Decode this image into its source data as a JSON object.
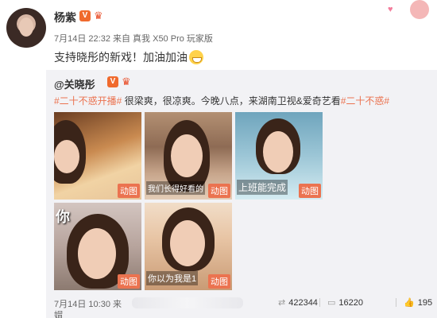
{
  "user": {
    "name": "杨紫",
    "verified_label": "V",
    "meta": "7月14日 22:32 来自 真我 X50 Pro 玩家版",
    "text": "支持晓彤的新戏！加油加油"
  },
  "repost": {
    "author": "@关晓彤",
    "verified_label": "V",
    "tag1": "#二十不惑开播#",
    "text_mid": " 很梁爽，很凉爽。今晚八点，来湖南卫视&爱奇艺看",
    "tag2": "#二十不惑#",
    "thumbs": [
      {
        "badge": "动图",
        "subtitle": ""
      },
      {
        "badge": "动图",
        "subtitle": "我们长得好看的"
      },
      {
        "badge": "动图",
        "subtitle": "上班能完成"
      },
      {
        "badge": "动图",
        "subtitle": "你"
      },
      {
        "badge": "动图",
        "subtitle": "你以为我是1"
      }
    ],
    "meta": "7月14日 10:30 来",
    "meta_second": "媢",
    "stats": {
      "reposts": "422344",
      "comments": "16220",
      "likes": "195"
    }
  },
  "colors": {
    "accent": "#eb7350",
    "verified": "#f06a2d",
    "repost_bg": "#f2f2f5"
  },
  "icons": [
    "repost-icon",
    "comment-icon",
    "like-icon",
    "crown-icon",
    "smile-emoji-icon"
  ]
}
